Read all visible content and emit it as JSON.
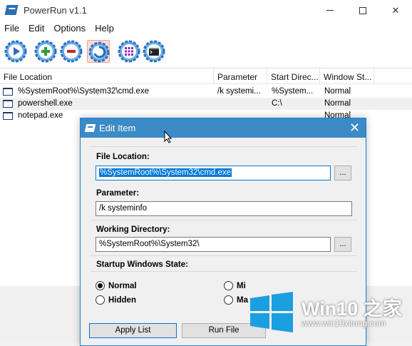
{
  "window": {
    "title": "PowerRun v1.1"
  },
  "menu": [
    "File",
    "Edit",
    "Options",
    "Help"
  ],
  "toolbar": [
    {
      "name": "run-button",
      "icon": "play-icon",
      "color": "#2d6fbf"
    },
    {
      "name": "add-button",
      "icon": "plus-icon",
      "color": "#2e9b3a"
    },
    {
      "name": "remove-button",
      "icon": "minus-icon",
      "color": "#d02424"
    },
    {
      "name": "edit-button",
      "icon": "edit-icon",
      "color": "#1f6fb5"
    },
    {
      "name": "select-all-button",
      "icon": "grid-icon",
      "color": "#8a2bb9"
    },
    {
      "name": "cmd-button",
      "icon": "console-icon",
      "color": "#222222"
    }
  ],
  "list": {
    "columns": [
      "File Location",
      "Parameter",
      "Start Direc...",
      "Window St..."
    ],
    "rows": [
      {
        "file": "%SystemRoot%\\System32\\cmd.exe",
        "param": "/k systemi...",
        "dir": "%System...",
        "state": "Normal"
      },
      {
        "file": "powershell.exe",
        "param": "",
        "dir": "C:\\",
        "state": "Normal"
      },
      {
        "file": "notepad.exe",
        "param": "",
        "dir": "",
        "state": "Normal"
      }
    ]
  },
  "dialog": {
    "title": "Edit Item",
    "file_location_label": "File Location:",
    "file_location_value": "%SystemRoot%\\System32\\cmd.exe",
    "parameter_label": "Parameter:",
    "parameter_value": "/k systeminfo",
    "working_dir_label": "Working Directory:",
    "working_dir_value": "%SystemRoot%\\System32\\",
    "browse_label": "...",
    "startup_label": "Startup Windows State:",
    "radios": [
      {
        "label": "Normal",
        "selected": true
      },
      {
        "label": "Hidden",
        "selected": false
      },
      {
        "label": "Mi",
        "selected": false
      },
      {
        "label": "Ma",
        "selected": false
      }
    ],
    "apply_list_label": "Apply List",
    "run_file_label": "Run File"
  },
  "watermark": {
    "title": "Win10 之家",
    "url": "www.win10xitong.com"
  },
  "colors": {
    "accent": "#0078d7",
    "dialog_title": "#3c8ac6"
  }
}
